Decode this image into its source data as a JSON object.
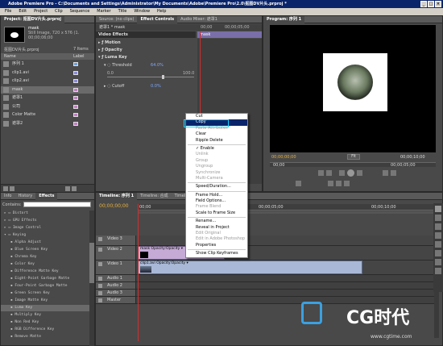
{
  "window": {
    "title": "Adobe Premiere Pro - C:\\Documents and Settings\\Administrator\\My Documents\\Adobe\\Premiere Pro\\2.0\\抠图DV片头.prproj *"
  },
  "menu": [
    "File",
    "Edit",
    "Project",
    "Clip",
    "Sequence",
    "Marker",
    "Title",
    "Window",
    "Help"
  ],
  "project": {
    "tab": "Project: 抠图DV片头.prproj",
    "tab2": "×",
    "clip_name": "mask",
    "clip_info": "Still Image, 720 x 576 (1.",
    "clip_duration": "00;00;06;00",
    "project_file": "抠图DV片头.prproj",
    "items_count": "7 Items",
    "col_name": "Name",
    "col_label": "Label",
    "items": [
      {
        "name": "序列 1",
        "label_color": "#6fa0d8"
      },
      {
        "name": "clip1.avi",
        "label_color": "#8a8ad8"
      },
      {
        "name": "clip2.avi",
        "label_color": "#8a8ad8"
      },
      {
        "name": "mask",
        "label_color": "#c080c0"
      },
      {
        "name": "遮罩1",
        "label_color": "#c080c0"
      },
      {
        "name": "公司",
        "label_color": "#c080c0"
      },
      {
        "name": "Color Matte",
        "label_color": "#c080c0"
      },
      {
        "name": "遮罩2",
        "label_color": "#c080c0"
      }
    ]
  },
  "effects_panel": {
    "tabs": [
      "Info",
      "History",
      "Effects"
    ],
    "search_label": "Contains:",
    "items": [
      "Distort",
      "GPU Effects",
      "Image Control",
      "Keying",
      "Alpha Adjust",
      "Blue Screen Key",
      "Chroma Key",
      "Color Key",
      "Difference Matte Key",
      "Eight-Point Garbage Matte",
      "Four-Point Garbage Matte",
      "Green Screen Key",
      "Image Matte Key",
      "Luma Key",
      "Multiply Key",
      "Non Red Key",
      "RGB Difference Key",
      "Remove Matte"
    ]
  },
  "effect_controls": {
    "tabs": [
      "Source: (no clips)",
      "Effect Controls",
      "Audio Mixer: 遮罩1"
    ],
    "header": "遮罩1 * mask",
    "timecode_start": "00;00",
    "timecode_end": "00;00;05;00",
    "clip_label": "mask",
    "video_effects": "Video Effects",
    "motion": "Motion",
    "opacity": "Opacity",
    "luma_key": "Luma Key",
    "threshold_label": "Threshold",
    "threshold_value": "64.0%",
    "range_min": "0.0",
    "range_max": "100.0",
    "cutoff_label": "Cutoff",
    "cutoff_value": "0.0%"
  },
  "context_menu": {
    "items": [
      {
        "label": "Cut",
        "state": "normal"
      },
      {
        "label": "Copy",
        "state": "selected"
      },
      {
        "label": "Paste Attributes",
        "state": "disabled"
      },
      {
        "label": "Clear",
        "state": "normal"
      },
      {
        "label": "Ripple Delete",
        "state": "normal"
      },
      {
        "sep": true
      },
      {
        "label": "✓ Enable",
        "state": "normal"
      },
      {
        "label": "Unlink",
        "state": "disabled"
      },
      {
        "label": "Group",
        "state": "disabled"
      },
      {
        "label": "Ungroup",
        "state": "disabled"
      },
      {
        "label": "Synchronize",
        "state": "disabled"
      },
      {
        "label": "Multi-Camera",
        "state": "disabled"
      },
      {
        "sep": true
      },
      {
        "label": "Speed/Duration...",
        "state": "normal"
      },
      {
        "sep": true
      },
      {
        "label": "Frame Hold...",
        "state": "normal"
      },
      {
        "label": "Field Options...",
        "state": "normal"
      },
      {
        "label": "Frame Blend",
        "state": "disabled"
      },
      {
        "label": "Scale to Frame Size",
        "state": "normal"
      },
      {
        "sep": true
      },
      {
        "label": "Rename...",
        "state": "normal"
      },
      {
        "label": "Reveal in Project",
        "state": "normal"
      },
      {
        "label": "Edit Original",
        "state": "disabled"
      },
      {
        "label": "Edit in Adobe Photoshop",
        "state": "disabled"
      },
      {
        "label": "Properties",
        "state": "normal"
      },
      {
        "sep": true
      },
      {
        "label": "Show Clip Keyframes",
        "state": "normal"
      }
    ]
  },
  "program": {
    "tab": "Program: 序列 1",
    "timecode_left": "00;00;00;00",
    "fit": "Fit",
    "timecode_right": "00;00;10;00",
    "ruler_start": "00;00",
    "ruler_end": "00;00;05;00"
  },
  "timeline": {
    "tabs": [
      "Timeline: 序列 1",
      "Timeline: 合成",
      "Timeline"
    ],
    "timecode": "00;00;00;00",
    "ruler": [
      "00;00",
      "00;00;05;00",
      "00;00;10;00"
    ],
    "tracks": [
      {
        "name": "Video 3",
        "type": "video"
      },
      {
        "name": "Video 2",
        "type": "video",
        "clip": "mask Opacity:Opacity ▾"
      },
      {
        "name": "Video 1",
        "type": "video",
        "clip": "clip1.avi Opacity:Opacity ▾"
      },
      {
        "name": "Audio 1",
        "type": "audio"
      },
      {
        "name": "Audio 2",
        "type": "audio"
      },
      {
        "name": "Audio 3",
        "type": "audio"
      },
      {
        "name": "Master",
        "type": "audio"
      }
    ]
  },
  "watermark": {
    "brand": "CG时代",
    "url": "www.cgtime.com"
  },
  "colors": {
    "accent_selection": "#0a246a",
    "playhead": "#d03030",
    "timecode": "#e8b13a",
    "effect_value": "#7fa8ff"
  }
}
